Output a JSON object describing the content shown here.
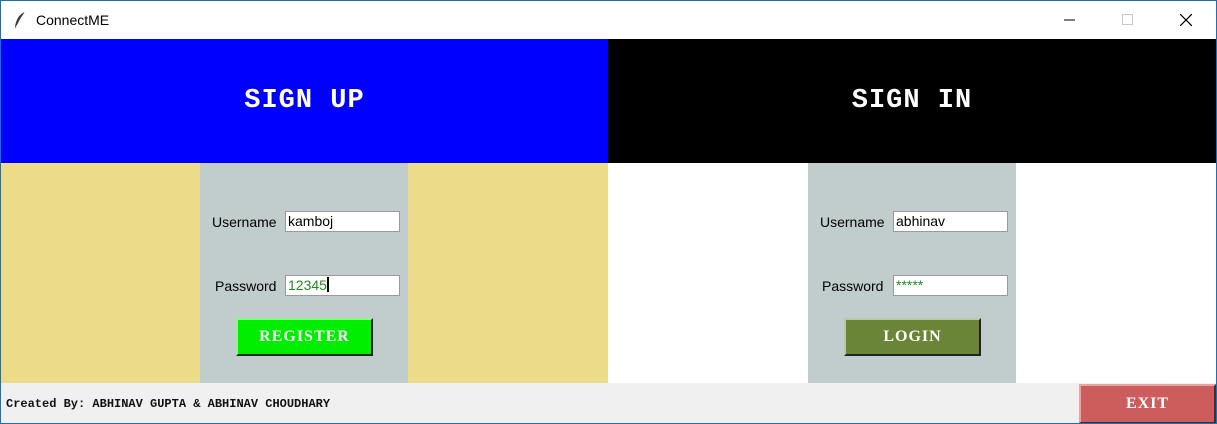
{
  "window": {
    "title": "ConnectME",
    "icon": "feather-icon",
    "controls": [
      "minimize-icon",
      "maximize-icon",
      "close-icon"
    ]
  },
  "signup": {
    "header": "SIGN UP",
    "username_label": "Username",
    "username_value": "kamboj",
    "password_label": "Password",
    "password_value": "12345",
    "button_label": "REGISTER"
  },
  "signin": {
    "header": "SIGN IN",
    "username_label": "Username",
    "username_value": "abhinav",
    "password_label": "Password",
    "password_value": "*****",
    "button_label": "LOGIN"
  },
  "footer": {
    "credits": "Created By: ABHINAV GUPTA & ABHINAV CHOUDHARY",
    "exit_label": "EXIT"
  },
  "colors": {
    "signup_header": "#0000ff",
    "signin_header": "#000000",
    "signup_body": "#ecdb88",
    "form_box": "#c1cdcd",
    "register_button": "#00ee00",
    "login_button": "#6b8538",
    "exit_button": "#cd5c5c",
    "password_text": "#1f8f1f"
  }
}
